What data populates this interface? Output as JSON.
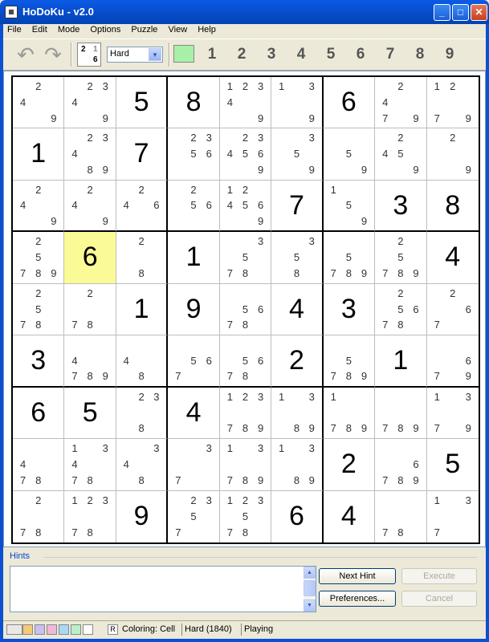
{
  "window": {
    "title": "HoDoKu - v2.0",
    "icon": "app-icon"
  },
  "menu": [
    "File",
    "Edit",
    "Mode",
    "Options",
    "Puzzle",
    "View",
    "Help"
  ],
  "toolbar": {
    "undo_icon": "undo-arrow-icon",
    "redo_icon": "redo-arrow-icon",
    "mode_icon_digits": [
      "2",
      "1",
      "6"
    ],
    "level": "Hard",
    "filter_digits": [
      "1",
      "2",
      "3",
      "4",
      "5",
      "6",
      "7",
      "8",
      "9"
    ],
    "active_color_primary": "#a8f0a8",
    "active_color_secondary": "#f2a3a3"
  },
  "grid": {
    "selected_cell": [
      3,
      1
    ],
    "selected_color": "#fafa96",
    "rows": [
      [
        {
          "c": [
            2,
            4,
            9
          ]
        },
        {
          "c": [
            2,
            3,
            4,
            9
          ]
        },
        {
          "v": 5
        },
        {
          "v": 8
        },
        {
          "c": [
            1,
            2,
            3,
            4,
            9
          ]
        },
        {
          "c": [
            1,
            3,
            9
          ]
        },
        {
          "v": 6
        },
        {
          "c": [
            2,
            4,
            7,
            9
          ]
        },
        {
          "c": [
            1,
            2,
            7,
            9
          ]
        }
      ],
      [
        {
          "v": 1
        },
        {
          "c": [
            2,
            3,
            4,
            8,
            9
          ]
        },
        {
          "v": 7
        },
        {
          "c": [
            2,
            3,
            5,
            6
          ]
        },
        {
          "c": [
            2,
            3,
            4,
            5,
            6,
            9
          ]
        },
        {
          "c": [
            3,
            5,
            9
          ]
        },
        {
          "c": [
            5,
            9
          ]
        },
        {
          "c": [
            2,
            4,
            5,
            9
          ]
        },
        {
          "c": [
            2,
            9
          ]
        }
      ],
      [
        {
          "c": [
            2,
            4,
            9
          ]
        },
        {
          "c": [
            2,
            4,
            9
          ]
        },
        {
          "c": [
            2,
            4,
            6
          ]
        },
        {
          "c": [
            2,
            5,
            6
          ]
        },
        {
          "c": [
            1,
            2,
            4,
            5,
            6,
            9
          ]
        },
        {
          "v": 7
        },
        {
          "c": [
            1,
            5,
            9
          ]
        },
        {
          "v": 3
        },
        {
          "v": 8
        }
      ],
      [
        {
          "c": [
            2,
            5,
            7,
            8,
            9
          ]
        },
        {
          "v": 6
        },
        {
          "c": [
            2,
            8
          ]
        },
        {
          "v": 1
        },
        {
          "c": [
            3,
            5,
            7,
            8
          ]
        },
        {
          "c": [
            3,
            5,
            8
          ]
        },
        {
          "c": [
            5,
            7,
            8,
            9
          ]
        },
        {
          "c": [
            2,
            5,
            7,
            8,
            9
          ]
        },
        {
          "v": 4
        }
      ],
      [
        {
          "c": [
            2,
            5,
            7,
            8
          ]
        },
        {
          "c": [
            2,
            7,
            8
          ]
        },
        {
          "v": 1
        },
        {
          "v": 9
        },
        {
          "c": [
            5,
            6,
            7,
            8
          ]
        },
        {
          "v": 4
        },
        {
          "v": 3
        },
        {
          "c": [
            2,
            5,
            6,
            7,
            8
          ]
        },
        {
          "c": [
            2,
            6,
            7
          ]
        }
      ],
      [
        {
          "v": 3
        },
        {
          "c": [
            4,
            7,
            8,
            9
          ]
        },
        {
          "c": [
            4,
            8
          ]
        },
        {
          "c": [
            5,
            6,
            7
          ]
        },
        {
          "c": [
            5,
            6,
            7,
            8
          ]
        },
        {
          "v": 2
        },
        {
          "c": [
            5,
            7,
            8,
            9
          ]
        },
        {
          "v": 1
        },
        {
          "c": [
            6,
            7,
            9
          ]
        }
      ],
      [
        {
          "v": 6
        },
        {
          "v": 5
        },
        {
          "c": [
            2,
            3,
            8
          ]
        },
        {
          "v": 4
        },
        {
          "c": [
            1,
            2,
            3,
            7,
            8,
            9
          ]
        },
        {
          "c": [
            1,
            3,
            8,
            9
          ]
        },
        {
          "c": [
            1,
            7,
            8,
            9
          ]
        },
        {
          "c": [
            7,
            8,
            9
          ]
        },
        {
          "c": [
            1,
            3,
            7,
            9
          ]
        }
      ],
      [
        {
          "c": [
            4,
            7,
            8
          ]
        },
        {
          "c": [
            1,
            3,
            4,
            7,
            8
          ]
        },
        {
          "c": [
            3,
            4,
            8
          ]
        },
        {
          "c": [
            3,
            7
          ]
        },
        {
          "c": [
            1,
            3,
            7,
            8,
            9
          ]
        },
        {
          "c": [
            1,
            3,
            8,
            9
          ]
        },
        {
          "v": 2
        },
        {
          "c": [
            6,
            7,
            8,
            9
          ]
        },
        {
          "v": 5
        }
      ],
      [
        {
          "c": [
            2,
            7,
            8
          ]
        },
        {
          "c": [
            1,
            2,
            3,
            7,
            8
          ]
        },
        {
          "v": 9
        },
        {
          "c": [
            2,
            3,
            5,
            7
          ]
        },
        {
          "c": [
            1,
            2,
            3,
            5,
            7,
            8
          ]
        },
        {
          "v": 6
        },
        {
          "v": 4
        },
        {
          "c": [
            7,
            8
          ]
        },
        {
          "c": [
            1,
            3,
            7
          ]
        }
      ]
    ]
  },
  "hints": {
    "label": "Hints",
    "text": "",
    "next_hint": "Next Hint",
    "execute": "Execute",
    "preferences": "Preferences...",
    "cancel": "Cancel"
  },
  "status": {
    "swatches": [
      "#e8e8e8",
      "#f5c87a",
      "#c8c0f0",
      "#f0b8d8",
      "#a8d8f8",
      "#b8f0c8",
      "#ffffff"
    ],
    "reset_label": "R",
    "coloring": "Coloring: Cell",
    "difficulty": "Hard (1840)",
    "state": "Playing"
  }
}
